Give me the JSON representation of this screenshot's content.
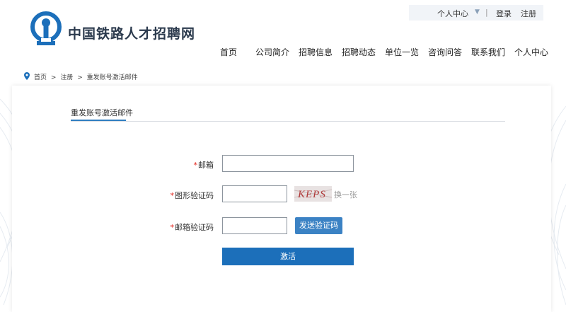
{
  "header": {
    "site_title": "中国铁路人才招聘网",
    "user_center": "个人中心",
    "separator": "|",
    "login": "登录",
    "register": "注册"
  },
  "nav": {
    "items": [
      "首页",
      "公司简介",
      "招聘信息",
      "招聘动态",
      "单位一览",
      "咨询问答",
      "联系我们",
      "个人中心"
    ]
  },
  "breadcrumb": {
    "items": [
      "首页",
      ">",
      "注册",
      ">",
      "重发账号激活邮件"
    ]
  },
  "form": {
    "tab_label": "重发账号激活邮件",
    "required_mark": "*",
    "email_label": "邮箱",
    "email_value": "",
    "captcha_label": "图形验证码",
    "captcha_value": "",
    "captcha_text": "KEPS",
    "swap_label": "换一张",
    "email_code_label": "邮箱验证码",
    "email_code_value": "",
    "send_code_button": "发送验证码",
    "activate_button": "激活"
  },
  "colors": {
    "brand_blue": "#1c6fba",
    "required_red": "#e2231a"
  },
  "icons": {
    "logo": "railway-logo-icon",
    "location": "location-pin-icon",
    "dropdown": "chevron-down-icon"
  }
}
